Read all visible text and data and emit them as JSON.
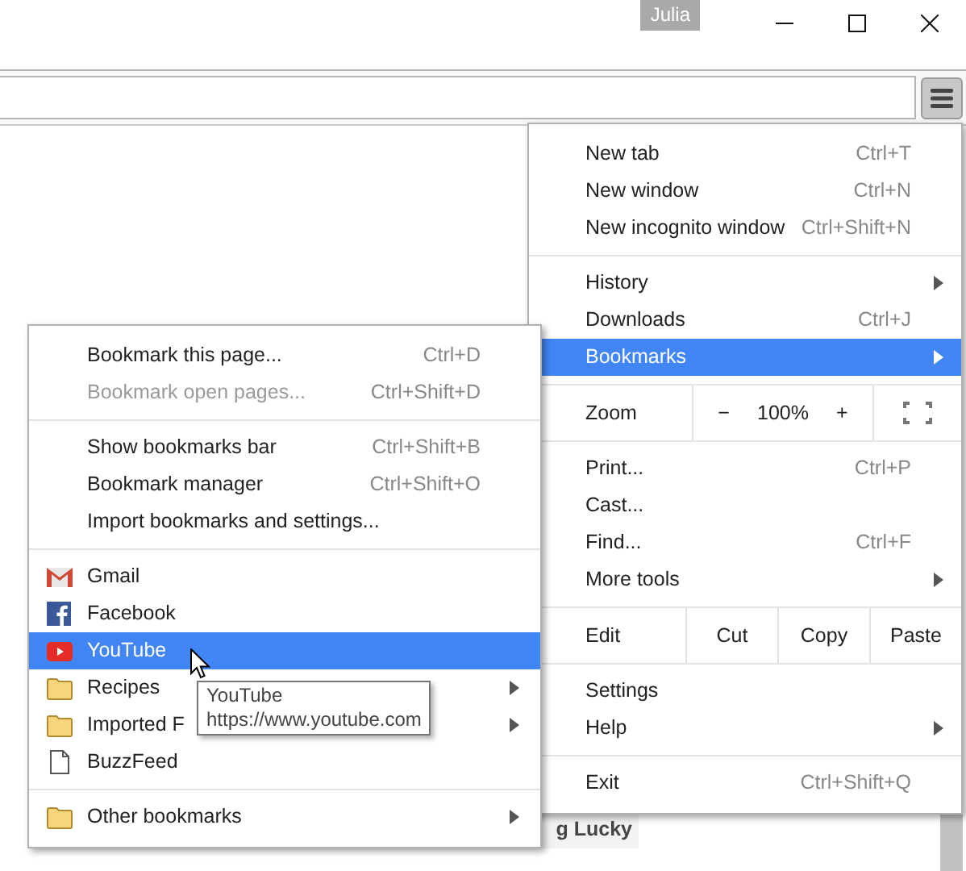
{
  "window": {
    "user": "Julia"
  },
  "page": {
    "button": "g Lucky"
  },
  "main_menu": {
    "sections": [
      [
        {
          "kind": "item",
          "label": "New tab",
          "shortcut": "Ctrl+T",
          "selected": false
        },
        {
          "kind": "item",
          "label": "New window",
          "shortcut": "Ctrl+N",
          "selected": false
        },
        {
          "kind": "item",
          "label": "New incognito window",
          "shortcut": "Ctrl+Shift+N",
          "selected": false
        }
      ],
      [
        {
          "kind": "item",
          "label": "History",
          "has_submenu": true,
          "selected": false
        },
        {
          "kind": "item",
          "label": "Downloads",
          "shortcut": "Ctrl+J",
          "selected": false
        },
        {
          "kind": "item",
          "label": "Bookmarks",
          "has_submenu": true,
          "selected": true
        }
      ],
      [
        {
          "kind": "zoom",
          "label": "Zoom",
          "minus": "−",
          "value": "100%",
          "plus": "+"
        }
      ],
      [
        {
          "kind": "item",
          "label": "Print...",
          "shortcut": "Ctrl+P",
          "selected": false
        },
        {
          "kind": "item",
          "label": "Cast...",
          "selected": false
        },
        {
          "kind": "item",
          "label": "Find...",
          "shortcut": "Ctrl+F",
          "selected": false
        },
        {
          "kind": "item",
          "label": "More tools",
          "has_submenu": true,
          "selected": false
        }
      ],
      [
        {
          "kind": "edit",
          "label": "Edit",
          "buttons": [
            "Cut",
            "Copy",
            "Paste"
          ]
        }
      ],
      [
        {
          "kind": "item",
          "label": "Settings",
          "selected": false
        },
        {
          "kind": "item",
          "label": "Help",
          "has_submenu": true,
          "selected": false
        }
      ],
      [
        {
          "kind": "item",
          "label": "Exit",
          "shortcut": "Ctrl+Shift+Q",
          "selected": false
        }
      ]
    ]
  },
  "bookmarks_menu": {
    "sections": [
      [
        {
          "label": "Bookmark this page...",
          "shortcut": "Ctrl+D",
          "disabled": false
        },
        {
          "label": "Bookmark open pages...",
          "shortcut": "Ctrl+Shift+D",
          "disabled": true
        }
      ],
      [
        {
          "label": "Show bookmarks bar",
          "shortcut": "Ctrl+Shift+B",
          "disabled": false
        },
        {
          "label": "Bookmark manager",
          "shortcut": "Ctrl+Shift+O",
          "disabled": false
        },
        {
          "label": "Import bookmarks and settings...",
          "disabled": false
        }
      ],
      [
        {
          "kind": "gmail",
          "label": "Gmail",
          "selected": false
        },
        {
          "kind": "facebook",
          "label": "Facebook",
          "selected": false
        },
        {
          "kind": "youtube",
          "label": "YouTube",
          "selected": true
        },
        {
          "kind": "folder",
          "label": "Recipes",
          "has_submenu": true,
          "selected": false
        },
        {
          "kind": "folder",
          "label": "Imported F",
          "has_submenu": true,
          "selected": false
        },
        {
          "kind": "page",
          "label": "BuzzFeed",
          "selected": false
        }
      ],
      [
        {
          "kind": "folder",
          "label": "Other bookmarks",
          "has_submenu": true,
          "selected": false
        }
      ]
    ]
  },
  "tooltip": {
    "title": "YouTube",
    "url": "https://www.youtube.com"
  }
}
